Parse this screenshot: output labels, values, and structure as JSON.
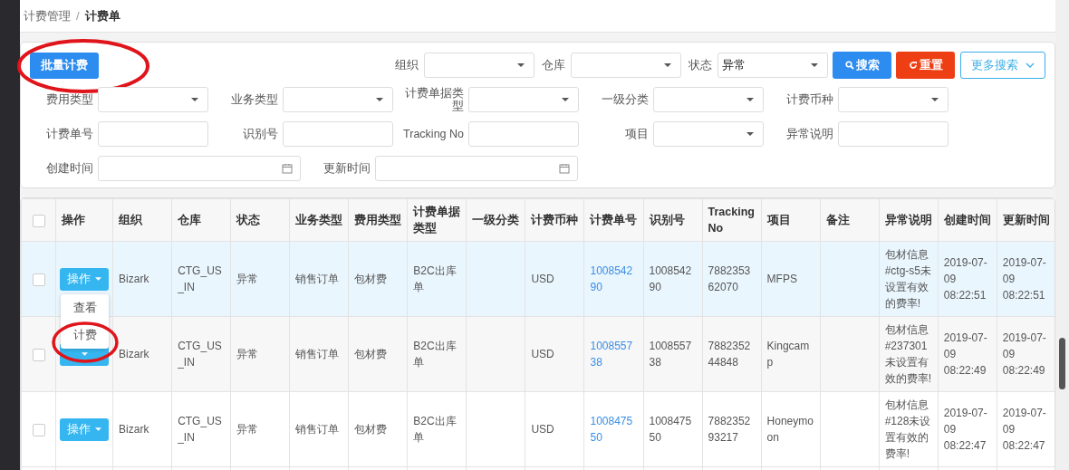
{
  "breadcrumb": {
    "parent": "计费管理",
    "separator": "/",
    "current": "计费单"
  },
  "toolbar": {
    "batch_button": "批量计费",
    "top_filters": [
      {
        "kind": "select",
        "label": "组织"
      },
      {
        "kind": "select",
        "label": "仓库"
      },
      {
        "kind": "select",
        "label": "状态",
        "value": "异常"
      }
    ],
    "search_button": "搜索",
    "reset_button": "重置",
    "more_button": "更多搜索"
  },
  "filter_rows": [
    [
      {
        "kind": "select",
        "label": "费用类型"
      },
      {
        "kind": "select",
        "label": "业务类型"
      },
      {
        "kind": "select",
        "label": "计费单据类型"
      },
      {
        "kind": "select",
        "label": "一级分类"
      },
      {
        "kind": "select",
        "label": "计费币种"
      }
    ],
    [
      {
        "kind": "input",
        "label": "计费单号"
      },
      {
        "kind": "input",
        "label": "识别号"
      },
      {
        "kind": "input",
        "label": "Tracking No"
      },
      {
        "kind": "select",
        "label": "项目"
      },
      {
        "kind": "input",
        "label": "异常说明"
      }
    ],
    [
      {
        "kind": "date",
        "label": "创建时间"
      },
      {
        "kind": "date",
        "label": "更新时间"
      }
    ]
  ],
  "table": {
    "header_checkbox": {
      "checked": false
    },
    "action_header": "操作",
    "columns": [
      {
        "label": "组织",
        "kind": "text"
      },
      {
        "label": "仓库",
        "kind": "text"
      },
      {
        "label": "状态",
        "kind": "text"
      },
      {
        "label": "业务类型",
        "kind": "text"
      },
      {
        "label": "费用类型",
        "kind": "text"
      },
      {
        "label": "计费单据类型",
        "kind": "text"
      },
      {
        "label": "一级分类"
      },
      {
        "label": "计费币种",
        "kind": "text"
      },
      {
        "label": "计费单号",
        "kind": "link"
      },
      {
        "label": "识别号",
        "kind": "text"
      },
      {
        "label": "Tracking No",
        "kind": "text"
      },
      {
        "label": "项目",
        "kind": "text"
      },
      {
        "label": "备注"
      },
      {
        "label": "异常说明",
        "kind": "text"
      },
      {
        "label": "创建时间",
        "kind": "text"
      },
      {
        "label": "更新时间",
        "kind": "text"
      }
    ],
    "rows": [
      {
        "highlighted": true,
        "checked": false,
        "menu_open": true,
        "action": "操作",
        "cells": [
          "Bizark",
          "CTG_US_IN",
          "异常",
          "销售订单",
          "包材费",
          "B2C出库单",
          "",
          "USD",
          "100854290",
          "100854290",
          "788235362070",
          "MFPS",
          "",
          "包材信息#ctg-s5未设置有效的费率!",
          "2019-07-09 08:22:51",
          "2019-07-09 08:22:51"
        ]
      },
      {
        "highlighted": false,
        "checked": false,
        "menu_open": false,
        "cells": [
          "Bizark",
          "CTG_US_IN",
          "异常",
          "销售订单",
          "包材费",
          "B2C出库单",
          "",
          "USD",
          "100855738",
          "100855738",
          "788235244848",
          "Kingcamp",
          "",
          "包材信息#237301未设置有效的费率!",
          "2019-07-09 08:22:49",
          "2019-07-09 08:22:49"
        ]
      },
      {
        "highlighted": false,
        "checked": false,
        "menu_open": false,
        "action": "操作",
        "cells": [
          "Bizark",
          "CTG_US_IN",
          "异常",
          "销售订单",
          "包材费",
          "B2C出库单",
          "",
          "USD",
          "100847550",
          "100847550",
          "788235293217",
          "Honeymoon",
          "",
          "包材信息#128未设置有效的费率!",
          "2019-07-09 08:22:47",
          "2019-07-09 08:22:47"
        ]
      }
    ]
  },
  "action_menu": {
    "items": [
      "查看",
      "计费"
    ]
  }
}
